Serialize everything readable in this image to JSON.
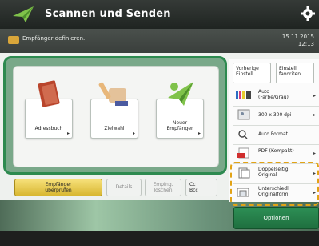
{
  "header": {
    "title": "Scannen und Senden"
  },
  "message": {
    "text": "Empfänger definieren.",
    "date": "15.11.2015",
    "time": "12:13"
  },
  "main": {
    "tiles": [
      {
        "label": "Adressbuch",
        "icon": "address-book-icon"
      },
      {
        "label": "Zielwahl",
        "icon": "speed-dial-icon"
      },
      {
        "label_line1": "Neuer",
        "label_line2": "Empfänger",
        "icon": "new-recipient-icon"
      }
    ],
    "recipient_button": {
      "line1": "Empfänger",
      "line2": "überprüfen"
    },
    "details_button": "Details",
    "delete_button": {
      "line1": "Empfng.",
      "line2": "löschen"
    },
    "ccbcc_button": {
      "line1": "Cc",
      "line2": "Bcc"
    }
  },
  "side": {
    "previous_settings": {
      "line1": "Vorherige",
      "line2": "Einstell."
    },
    "favorite_settings": {
      "line1": "Einstell.",
      "line2": "favoriten"
    },
    "color": {
      "line1": "Auto",
      "line2": "(Farbe/Grau)"
    },
    "resolution": "300 x 300 dpi",
    "format": "Auto Format",
    "file_type": "PDF (Kompakt)",
    "duplex": {
      "line1": "Doppelseitig.",
      "line2": "Original"
    },
    "different_sizes": {
      "line1": "Unterschiedl.",
      "line2": "Originalform."
    },
    "options": "Optionen"
  },
  "colors": {
    "accent_green": "#2d8a4f",
    "recipient_yellow": "#e6c84a",
    "highlight_orange": "#e2a316"
  }
}
